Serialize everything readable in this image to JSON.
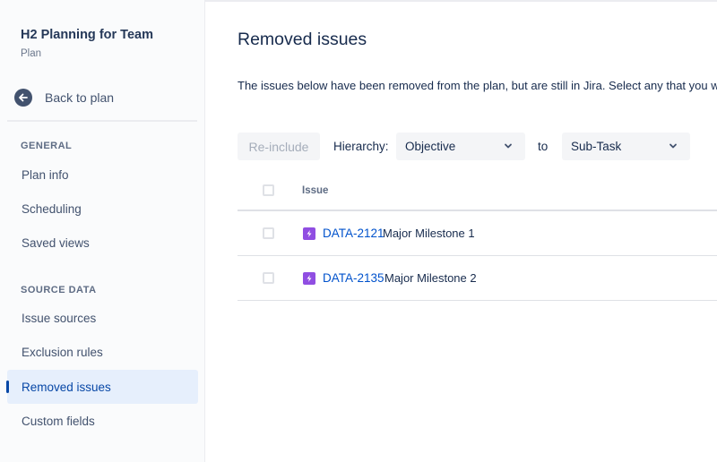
{
  "sidebar": {
    "plan_title": "H2 Planning for Team",
    "plan_subtitle": "Plan",
    "back_label": "Back to plan",
    "section_general": "GENERAL",
    "general_items": [
      {
        "label": "Plan info"
      },
      {
        "label": "Scheduling"
      },
      {
        "label": "Saved views"
      }
    ],
    "section_source": "SOURCE DATA",
    "source_items": [
      {
        "label": "Issue sources"
      },
      {
        "label": "Exclusion rules"
      },
      {
        "label": "Removed issues",
        "active": true
      },
      {
        "label": "Custom fields"
      }
    ]
  },
  "main": {
    "title": "Removed issues",
    "description": "The issues below have been removed from the plan, but are still in Jira. Select any that you want to re",
    "toolbar": {
      "reinclude_label": "Re-include",
      "hierarchy_label": "Hierarchy:",
      "from_value": "Objective",
      "to_label": "to",
      "to_value": "Sub-Task"
    },
    "table": {
      "header_issue": "Issue",
      "rows": [
        {
          "key": "DATA-2121",
          "summary": "Major Milestone 1",
          "icon": "epic-lightning-icon"
        },
        {
          "key": "DATA-2135",
          "summary": "Major Milestone 2",
          "icon": "epic-lightning-icon"
        }
      ]
    }
  },
  "colors": {
    "accent": "#0052CC",
    "active_nav_bg": "#E6EFFC",
    "issue_icon": "#904EE2"
  }
}
